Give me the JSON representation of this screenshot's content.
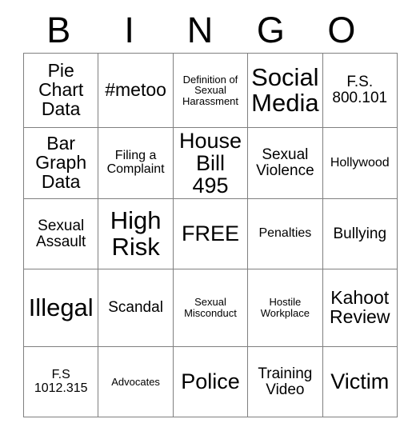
{
  "card": {
    "title": "BINGO",
    "header_letters": [
      "B",
      "I",
      "N",
      "G",
      "O"
    ],
    "grid_border_color": "#808080",
    "text_color": "#000000",
    "background_color": "#ffffff",
    "free_space": "FREE",
    "rows": [
      [
        {
          "text": "Pie Chart Data",
          "size": "fs-l"
        },
        {
          "text": "#metoo",
          "size": "fs-l"
        },
        {
          "text": "Definition of Sexual Harassment",
          "size": "fs-xs"
        },
        {
          "text": "Social Media",
          "size": "fs-xxl"
        },
        {
          "text": "F.S. 800.101",
          "size": "fs-m"
        }
      ],
      [
        {
          "text": "Bar Graph Data",
          "size": "fs-l"
        },
        {
          "text": "Filing a Complaint",
          "size": "fs-s"
        },
        {
          "text": "House Bill 495",
          "size": "fs-xl"
        },
        {
          "text": "Sexual Violence",
          "size": "fs-m"
        },
        {
          "text": "Hollywood",
          "size": "fs-s"
        }
      ],
      [
        {
          "text": "Sexual Assault",
          "size": "fs-m"
        },
        {
          "text": "High Risk",
          "size": "fs-xxl"
        },
        {
          "text": "FREE",
          "size": "fs-xl"
        },
        {
          "text": "Penalties",
          "size": "fs-s"
        },
        {
          "text": "Bullying",
          "size": "fs-m"
        }
      ],
      [
        {
          "text": "Illegal",
          "size": "fs-xxl"
        },
        {
          "text": "Scandal",
          "size": "fs-m"
        },
        {
          "text": "Sexual Misconduct",
          "size": "fs-xs"
        },
        {
          "text": "Hostile Workplace",
          "size": "fs-xs"
        },
        {
          "text": "Kahoot Review",
          "size": "fs-l"
        }
      ],
      [
        {
          "text": "F.S 1012.315",
          "size": "fs-s"
        },
        {
          "text": "Advocates",
          "size": "fs-xs"
        },
        {
          "text": "Police",
          "size": "fs-xl"
        },
        {
          "text": "Training Video",
          "size": "fs-m"
        },
        {
          "text": "Victim",
          "size": "fs-xl"
        }
      ]
    ]
  }
}
